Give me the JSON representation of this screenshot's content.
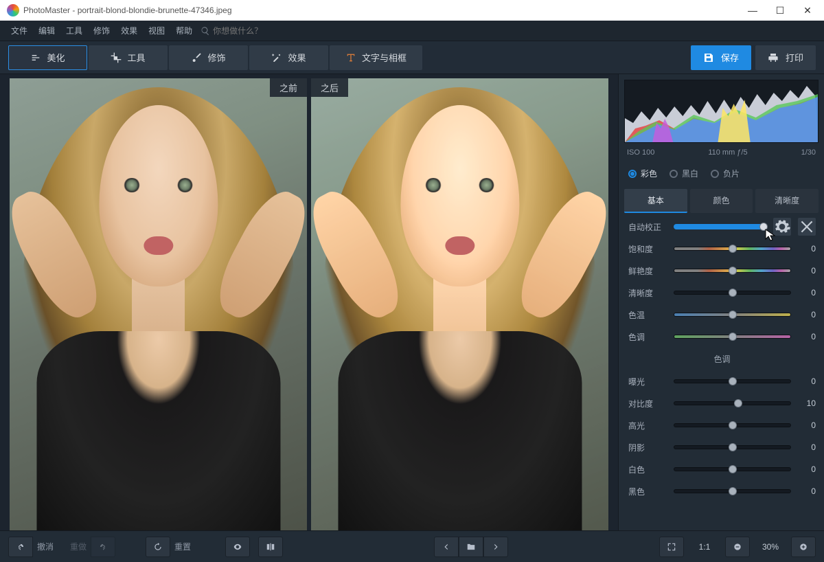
{
  "window": {
    "app": "PhotoMaster",
    "title": "PhotoMaster - portrait-blond-blondie-brunette-47346.jpeg"
  },
  "menu": {
    "items": [
      "文件",
      "编辑",
      "工具",
      "修饰",
      "效果",
      "视图",
      "帮助"
    ],
    "search_placeholder": "你想做什么？"
  },
  "tabs": {
    "beautify": "美化",
    "tools": "工具",
    "retouch": "修饰",
    "effects": "效果",
    "text": "文字与相框"
  },
  "actions": {
    "save": "保存",
    "print": "打印"
  },
  "compare": {
    "before": "之前",
    "after": "之后"
  },
  "meta": {
    "iso": "ISO 100",
    "focal": "110 mm ƒ/5",
    "shutter": "1/30"
  },
  "modes": {
    "color": "彩色",
    "bw": "黑白",
    "neg": "负片"
  },
  "subtabs": {
    "basic": "基本",
    "color": "颜色",
    "clarity": "清晰度"
  },
  "sliders": {
    "auto": "自动校正",
    "saturation": {
      "label": "饱和度",
      "value": 0
    },
    "vibrance": {
      "label": "鲜艳度",
      "value": 0
    },
    "clarity": {
      "label": "清晰度",
      "value": 0
    },
    "temperature": {
      "label": "色温",
      "value": 0
    },
    "tint": {
      "label": "色调",
      "value": 0
    },
    "tone_header": "色调",
    "exposure": {
      "label": "曝光",
      "value": 0
    },
    "contrast": {
      "label": "对比度",
      "value": 10
    },
    "highlights": {
      "label": "高光",
      "value": 0
    },
    "shadows": {
      "label": "阴影",
      "value": 0
    },
    "whites": {
      "label": "白色",
      "value": 0
    },
    "blacks": {
      "label": "黑色",
      "value": 0
    }
  },
  "bottom": {
    "undo": "撤消",
    "redo": "重做",
    "reset": "重置",
    "ratio": "1:1",
    "zoom": "30%"
  }
}
